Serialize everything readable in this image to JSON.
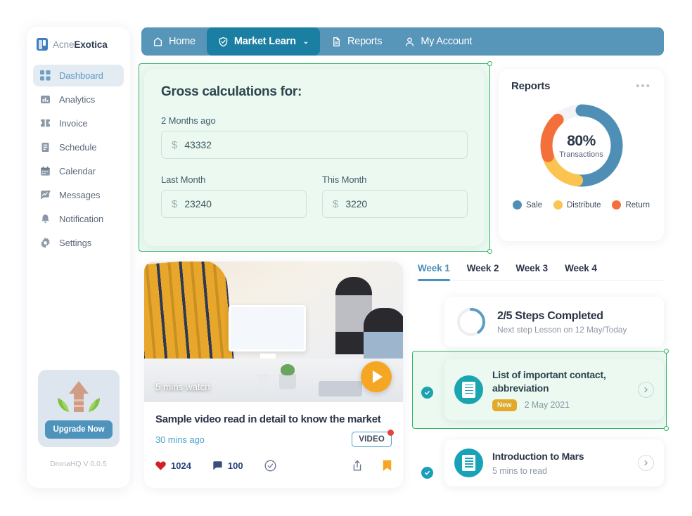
{
  "brand": {
    "prefix": "Acne",
    "suffix": "Exotica",
    "icon": "book-logo-icon"
  },
  "sidebar": {
    "items": [
      {
        "label": "Dashboard",
        "icon": "grid-icon"
      },
      {
        "label": "Analytics",
        "icon": "bar-chart-icon"
      },
      {
        "label": "Invoice",
        "icon": "invoice-icon"
      },
      {
        "label": "Schedule",
        "icon": "schedule-icon"
      },
      {
        "label": "Calendar",
        "icon": "calendar-icon"
      },
      {
        "label": "Messages",
        "icon": "message-chart-icon"
      },
      {
        "label": "Notification",
        "icon": "bell-icon"
      },
      {
        "label": "Settings",
        "icon": "gear-icon"
      }
    ],
    "upgrade_label": "Upgrade Now",
    "version": "DronaHQ V 0.0.5"
  },
  "topnav": {
    "items": [
      {
        "label": "Home",
        "icon": "home-icon",
        "selected": false,
        "caret": false
      },
      {
        "label": "Market Learn",
        "icon": "shield-check-icon",
        "selected": true,
        "caret": true
      },
      {
        "label": "Reports",
        "icon": "document-icon",
        "selected": false,
        "caret": false
      },
      {
        "label": "My Account",
        "icon": "user-icon",
        "selected": false,
        "caret": false
      }
    ],
    "caret_glyph": "⌄"
  },
  "gross": {
    "title": "Gross calculations for:",
    "currency": "$",
    "fields": [
      {
        "label": "2 Months ago",
        "value": "43332"
      },
      {
        "label": "Last Month",
        "value": "23240"
      },
      {
        "label": "This Month",
        "value": "3220"
      }
    ]
  },
  "reports": {
    "title": "Reports",
    "menu_glyph": "•••",
    "center_value": "80%",
    "center_label": "Transactions"
  },
  "chart_data": {
    "type": "pie",
    "title": "Reports",
    "subtype": "donut",
    "center_text": "80%",
    "center_sublabel": "Transactions",
    "categories": [
      "Sale",
      "Distribute",
      "Return"
    ],
    "values": [
      52,
      18,
      18
    ],
    "track_remainder": 12,
    "colors": [
      "#4f8fb5",
      "#fbc34f",
      "#f4703a"
    ],
    "track_color": "#f3f3f7",
    "legend_position": "bottom",
    "start_angle_deg": 0,
    "units": "percent of ring"
  },
  "video": {
    "duration_badge": "5 mins watch",
    "title": "Sample video read in detail to know the market",
    "time_ago": "30 mins ago",
    "tag": "VIDEO",
    "likes": "1024",
    "comments": "100",
    "icons": {
      "play": "play-icon",
      "heart": "heart-icon",
      "comment": "comment-icon",
      "check": "check-circle-icon",
      "share": "share-icon",
      "bookmark": "bookmark-icon"
    }
  },
  "weeks": {
    "tabs": [
      {
        "label": "Week 1",
        "active": true
      },
      {
        "label": "Week 2",
        "active": false
      },
      {
        "label": "Week 3",
        "active": false
      },
      {
        "label": "Week 4",
        "active": false
      }
    ],
    "steps": {
      "title": "2/5 Steps Completed",
      "subtitle": "Next step Lesson on 12 May/Today",
      "progress_percent": 40
    },
    "lessons": [
      {
        "title": "List of important contact, abbreviation",
        "badge": "New",
        "date": "2 May 2021",
        "icon": "document-circle-icon",
        "selected": true
      },
      {
        "title": "Introduction to Mars",
        "badge": "",
        "date": "5 mins to read",
        "icon": "document-circle-icon",
        "selected": false
      }
    ]
  },
  "colors": {
    "nav_bar": "#5795b9",
    "nav_selected": "#1b7fa3",
    "selection_green": "#2fb463",
    "accent_teal": "#17a2b8",
    "accent_orange": "#f5a623",
    "sale_blue": "#4f8fb5",
    "distribute_yellow": "#fbc34f",
    "return_orange": "#f4703a"
  }
}
